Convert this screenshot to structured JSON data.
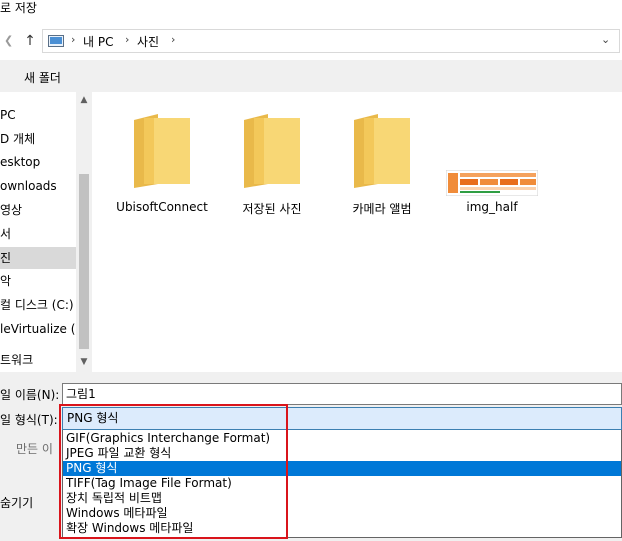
{
  "window": {
    "title": "로 저장"
  },
  "address": {
    "crumbs": [
      "내 PC",
      "사진"
    ]
  },
  "toolbar": {
    "new_folder_label": "새 폴더"
  },
  "left_pane": {
    "items": [
      {
        "label": "PC",
        "selected": false
      },
      {
        "label": "D 개체",
        "selected": false
      },
      {
        "label": "esktop",
        "selected": false
      },
      {
        "label": "ownloads",
        "selected": false
      },
      {
        "label": "영상",
        "selected": false
      },
      {
        "label": "서",
        "selected": false
      },
      {
        "label": "진",
        "selected": true
      },
      {
        "label": "악",
        "selected": false
      },
      {
        "label": "컬 디스크 (C:)",
        "selected": false
      },
      {
        "label": "leVirtualize (W",
        "selected": false
      },
      {
        "label": "트워크",
        "selected": false
      }
    ]
  },
  "files": [
    {
      "name": "UbisoftConnect",
      "type": "folder"
    },
    {
      "name": "저장된 사진",
      "type": "folder"
    },
    {
      "name": "카메라 앨범",
      "type": "folder"
    },
    {
      "name": "img_half",
      "type": "image"
    }
  ],
  "form": {
    "file_name_label": "일 이름(N):",
    "file_name_value": "그림1",
    "file_type_label": "일 형식(T):",
    "file_type_selected": "PNG 형식",
    "author_label": "만든 이",
    "hide_folders_label": "숨기기"
  },
  "file_type_options": [
    "GIF(Graphics Interchange Format)",
    "JPEG 파일 교환 형식",
    "PNG 형식",
    "TIFF(Tag Image File Format)",
    "장치 독립적 비트맵",
    "Windows 메타파일",
    "확장 Windows 메타파일"
  ],
  "file_type_selected_index": 2,
  "colors": {
    "selection": "#0078d7",
    "highlight_box": "#d9141b",
    "folder": "#f8d775"
  },
  "icons": [
    "back-arrow-icon",
    "up-arrow-icon",
    "pc-icon",
    "chevron-right-icon",
    "chevron-down-icon",
    "folder-icon"
  ]
}
